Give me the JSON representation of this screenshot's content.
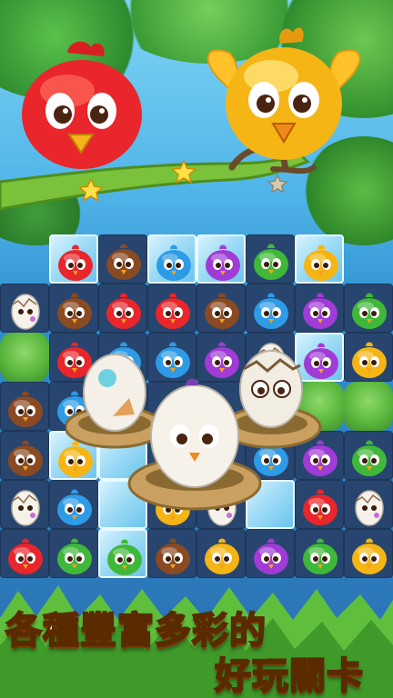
{
  "headline": {
    "line1": "各種豐富多彩的",
    "line2": "好玩關卡"
  },
  "colors": {
    "red": "#e8262b",
    "brown": "#8a4a22",
    "blue": "#2e9be6",
    "purple": "#a03bd6",
    "green": "#3fb83a",
    "yellow": "#f5b514",
    "accent_text_outline": "#5a2a00"
  },
  "board": {
    "rows": [
      [
        "blank",
        "red",
        "brown",
        "blue",
        "purple",
        "green",
        "yellow",
        "blank"
      ],
      [
        "egg",
        "brown",
        "red",
        "red",
        "brown",
        "blue",
        "purple",
        "green"
      ],
      [
        "bush",
        "red",
        "blue",
        "blue",
        "purple",
        "egg",
        "purple",
        "yellow"
      ],
      [
        "brown",
        "blue",
        "nest",
        "nest",
        "nest",
        "nest",
        "bush",
        "bush"
      ],
      [
        "brown",
        "yellow",
        "ice",
        "nest",
        "nest",
        "blue",
        "purple",
        "green"
      ],
      [
        "egg",
        "blue",
        "ice",
        "yellow",
        "egg",
        "ice",
        "red",
        "egg"
      ],
      [
        "red",
        "green",
        "green",
        "brown",
        "yellow",
        "purple",
        "green",
        "yellow"
      ]
    ],
    "ice_cells": [
      [
        0,
        1
      ],
      [
        0,
        3
      ],
      [
        0,
        4
      ],
      [
        0,
        6
      ],
      [
        2,
        6
      ],
      [
        4,
        1
      ],
      [
        4,
        2
      ],
      [
        5,
        2
      ],
      [
        5,
        5
      ],
      [
        6,
        2
      ]
    ]
  },
  "characters": [
    {
      "name": "red-bird",
      "color": "red"
    },
    {
      "name": "yellow-bird",
      "color": "yellow"
    }
  ],
  "icons": [
    "star-icon",
    "branch",
    "nest",
    "egg-icon",
    "chick-icon"
  ]
}
